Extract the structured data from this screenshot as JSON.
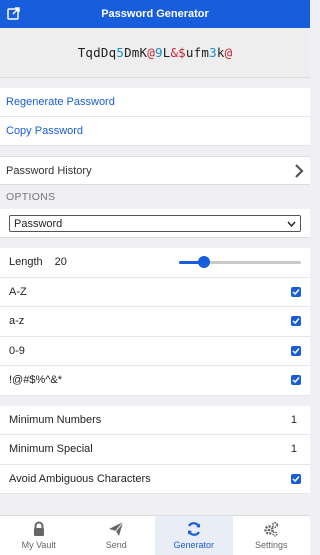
{
  "header": {
    "title": "Password Generator"
  },
  "password": {
    "chars": [
      {
        "c": "Tqd",
        "color": "#222222"
      },
      {
        "c": "Dq",
        "color": "#222222"
      },
      {
        "c": "5",
        "color": "#1a8fc9"
      },
      {
        "c": "DmK",
        "color": "#222222"
      },
      {
        "c": "@",
        "color": "#c8202f"
      },
      {
        "c": "9",
        "color": "#1a8fc9"
      },
      {
        "c": "L",
        "color": "#222222"
      },
      {
        "c": "&$",
        "color": "#c8202f"
      },
      {
        "c": "ufm",
        "color": "#222222"
      },
      {
        "c": "3",
        "color": "#1a8fc9"
      },
      {
        "c": "k",
        "color": "#222222"
      },
      {
        "c": "@",
        "color": "#c8202f"
      }
    ]
  },
  "actions": {
    "regenerate": "Regenerate Password",
    "copy": "Copy Password"
  },
  "history": {
    "label": "Password History"
  },
  "options": {
    "heading": "OPTIONS",
    "type_selected": "Password",
    "length_label": "Length",
    "length_value": "20",
    "length_slider_fraction": 0.17,
    "toggles": [
      {
        "label": "A-Z",
        "checked": true
      },
      {
        "label": "a-z",
        "checked": true
      },
      {
        "label": "0-9",
        "checked": true
      },
      {
        "label": "!@#$%^&*",
        "checked": true
      }
    ],
    "min_numbers_label": "Minimum Numbers",
    "min_numbers_value": "1",
    "min_special_label": "Minimum Special",
    "min_special_value": "1",
    "avoid_ambiguous_label": "Avoid Ambiguous Characters",
    "avoid_ambiguous_checked": true
  },
  "tabs": [
    {
      "label": "My Vault",
      "icon": "lock-icon"
    },
    {
      "label": "Send",
      "icon": "paper-plane-icon"
    },
    {
      "label": "Generator",
      "icon": "refresh-icon",
      "active": true
    },
    {
      "label": "Settings",
      "icon": "gears-icon"
    }
  ],
  "colors": {
    "accent": "#175ddc",
    "number": "#1a8fc9",
    "special": "#c8202f"
  }
}
